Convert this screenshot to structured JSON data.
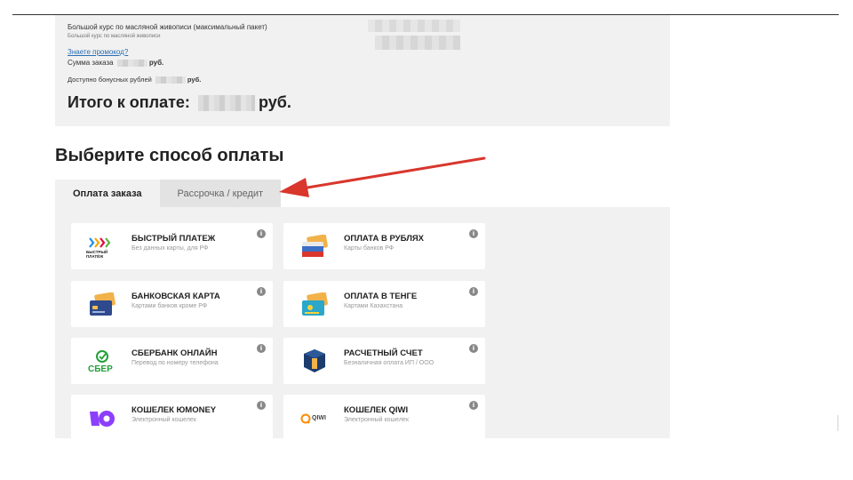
{
  "order": {
    "course_title": "Большой курс по масляной живописи (максимальный пакет)",
    "course_subtitle": "Большой курс по масляной живописи",
    "promo_link": "Знаете промокод?",
    "sum_label": "Сумма заказа",
    "sum_suffix": "руб.",
    "bonus_label": "Доступно бонусных рублей",
    "bonus_suffix": "руб.",
    "total_label": "Итого к оплате:",
    "total_suffix": "руб."
  },
  "payment": {
    "heading": "Выберите способ оплаты",
    "tabs": [
      {
        "label": "Оплата заказа",
        "active": true
      },
      {
        "label": "Рассрочка / кредит",
        "active": false
      }
    ],
    "methods": [
      {
        "title": "БЫСТРЫЙ ПЛАТЕЖ",
        "subtitle": "Без данных карты, для РФ",
        "icon": "fast-payment-icon",
        "icon_text": "БЫСТРЫЙ ПЛАТЁЖ"
      },
      {
        "title": "ОПЛАТА В РУБЛЯХ",
        "subtitle": "Карты банков РФ",
        "icon": "russian-card-icon"
      },
      {
        "title": "БАНКОВСКАЯ КАРТА",
        "subtitle": "Картами банков кроме РФ",
        "icon": "bank-card-icon"
      },
      {
        "title": "ОПЛАТА В ТЕНГЕ",
        "subtitle": "Картами Казахстана",
        "icon": "kazakhstan-card-icon"
      },
      {
        "title": "СБЕРБАНК ОНЛАЙН",
        "subtitle": "Перевод по номеру телефона",
        "icon": "sber-icon",
        "icon_text": "СБЕР"
      },
      {
        "title": "РАСЧЕТНЫЙ СЧЕТ",
        "subtitle": "Безналичная оплата ИП / ООО",
        "icon": "bank-account-icon"
      },
      {
        "title": "КОШЕЛЕК ЮMONEY",
        "subtitle": "Электронный кошелек",
        "icon": "yoomoney-icon"
      },
      {
        "title": "КОШЕЛЕК QIWI",
        "subtitle": "Электронный кошелек",
        "icon": "qiwi-icon",
        "icon_text": "QIWI"
      }
    ],
    "info_glyph": "i"
  },
  "colors": {
    "panel": "#f1f1f1",
    "link": "#2a6db5",
    "arrow": "#d9362c",
    "sber_green": "#21a038",
    "yoomoney_purple": "#8b3ffd",
    "qiwi_orange": "#ff8c00"
  }
}
